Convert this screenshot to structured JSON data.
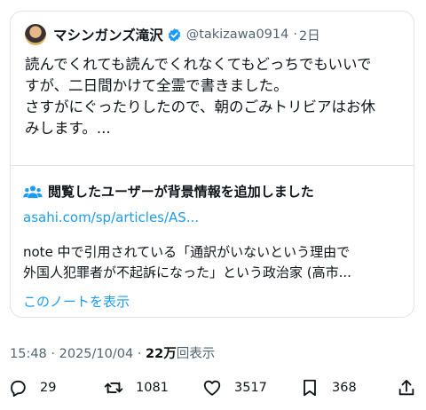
{
  "quoted_post": {
    "author_name": "マシンガンズ滝沢",
    "handle": "@takizawa0914",
    "separator": "·",
    "time_ago": "2日",
    "text_lines": [
      "読んでくれても読んでくれなくてもどっちでもいいで",
      "すが、二日間かけて全霊で書きました。",
      "さすがにぐったりしたので、朝のごみトリビアはお休",
      "みします。..."
    ]
  },
  "community_note": {
    "title": "閲覧したユーザーが背景情報を追加しました",
    "link_text": "asahi.com/sp/articles/AS...",
    "body_lines": [
      "note 中で引用されている「通訳がいないという理由で",
      "外国人犯罪者が不起訴になった」という政治家 (高市..."
    ],
    "show_note_label": "このノートを表示"
  },
  "post_meta": {
    "time": "15:48",
    "separator": "·",
    "date": "2025/10/04",
    "views_count": "22万",
    "views_label": "回表示"
  },
  "actions": {
    "replies": "29",
    "reposts": "1081",
    "likes": "3517",
    "bookmarks": "368"
  },
  "colors": {
    "accent": "#1d9bf0",
    "muted_text": "#536471",
    "border": "#dfe3e6"
  },
  "icons": [
    "verified-badge-icon",
    "people-icon",
    "reply-icon",
    "repost-icon",
    "like-icon",
    "bookmark-icon",
    "share-icon"
  ]
}
